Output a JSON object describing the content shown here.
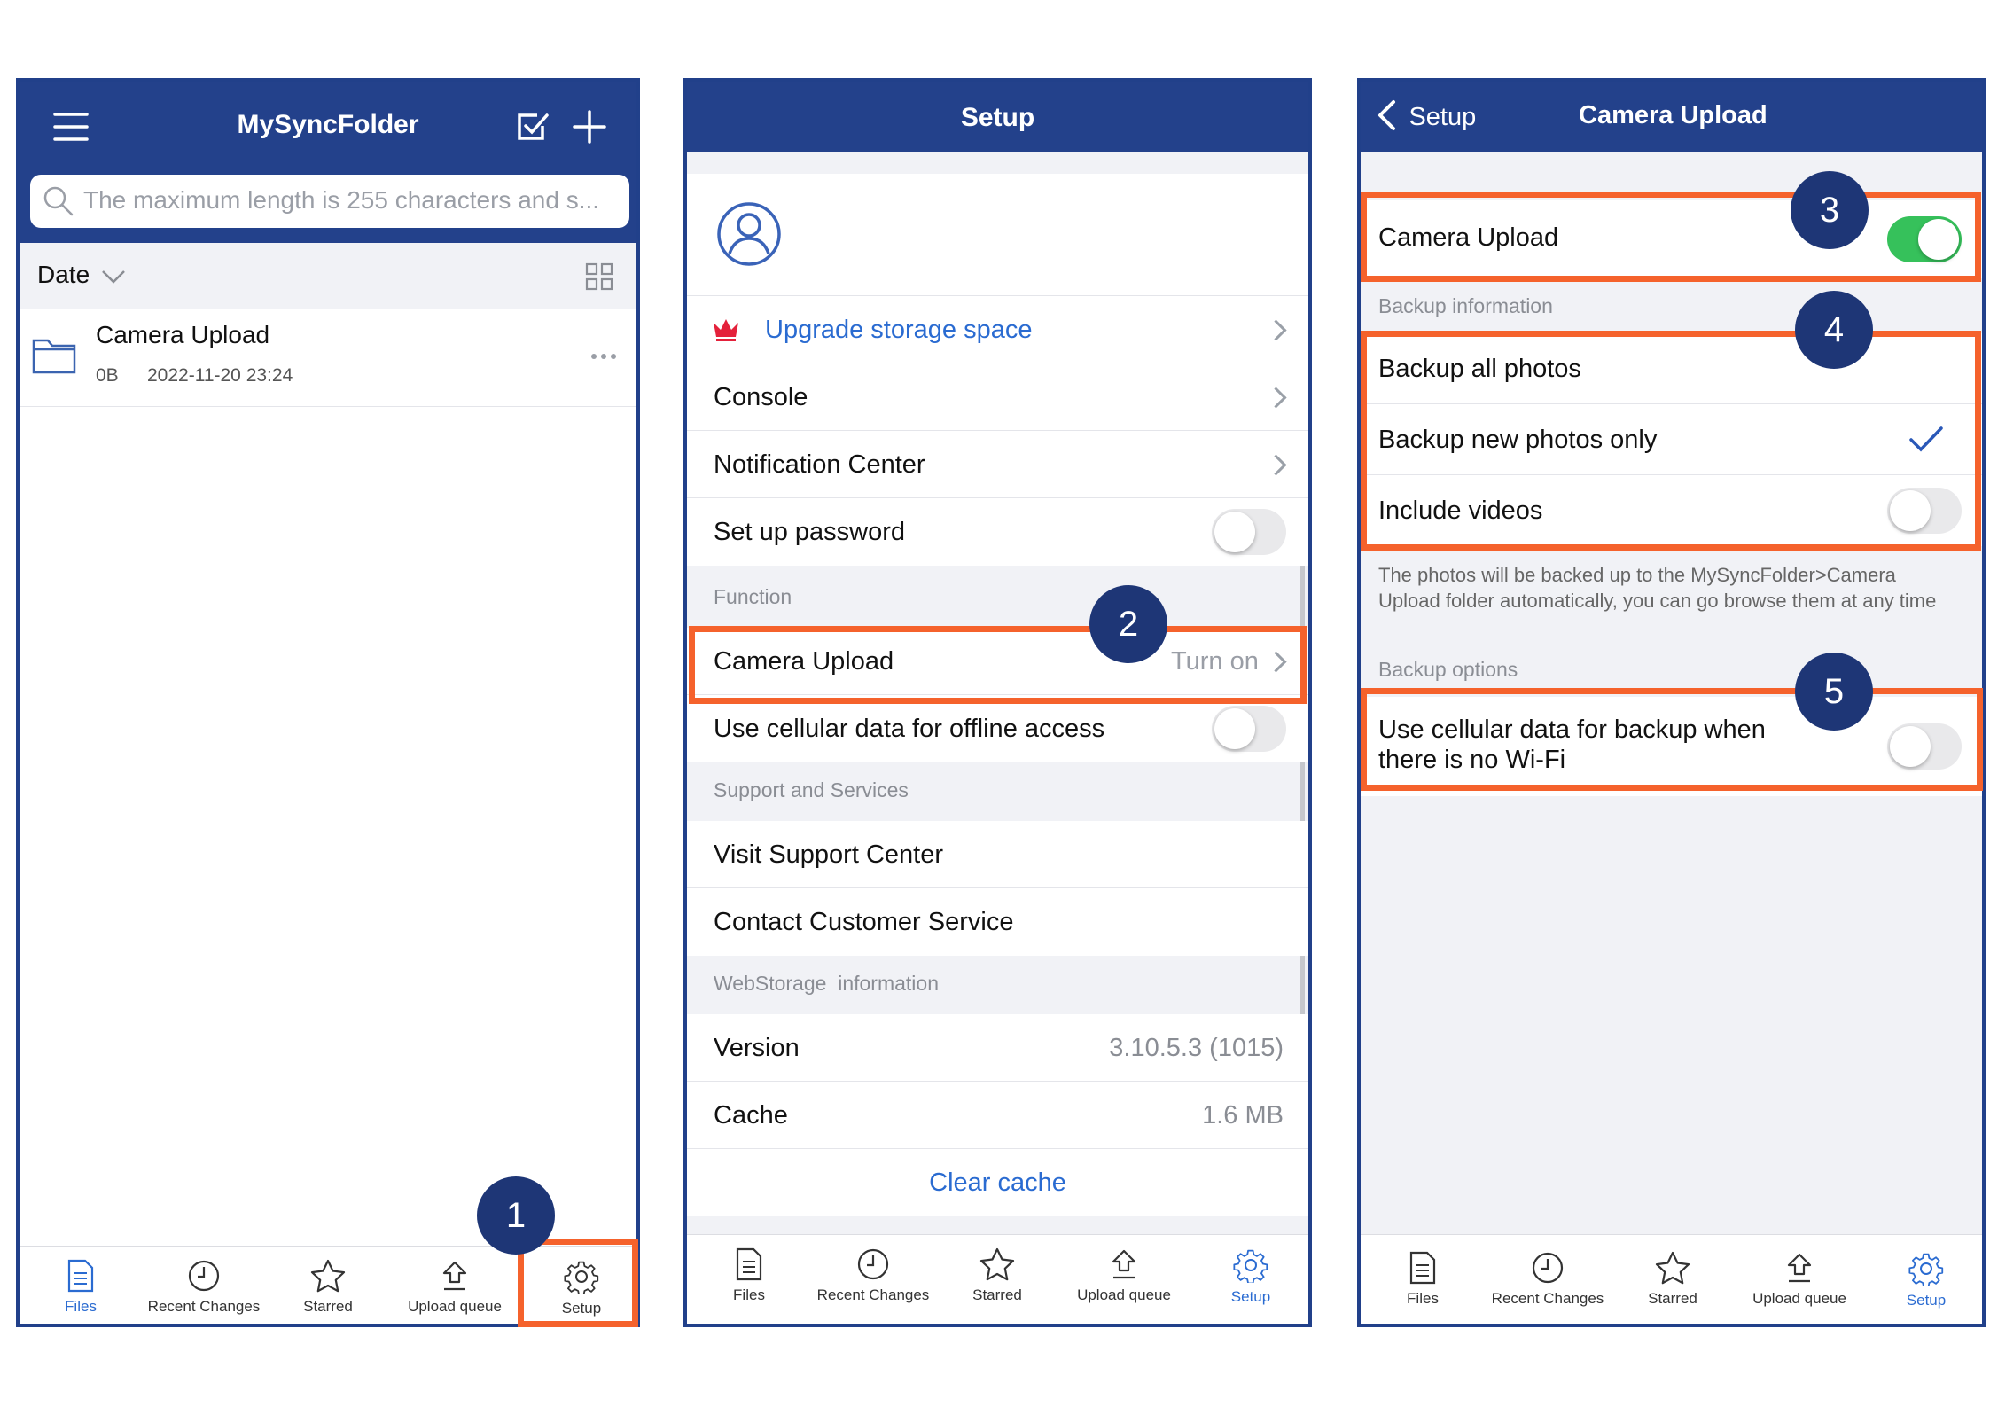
{
  "screen1": {
    "title": "MySyncFolder",
    "search_placeholder": "The maximum length is 255 characters and s...",
    "sort_label": "Date",
    "file": {
      "name": "Camera Upload",
      "size": "0B",
      "date": "2022-11-20 23:24"
    },
    "tabs": [
      "Files",
      "Recent Changes",
      "Starred",
      "Upload queue",
      "Setup"
    ],
    "badge": "1"
  },
  "screen2": {
    "title": "Setup",
    "upgrade": "Upgrade storage space",
    "console": "Console",
    "notification": "Notification Center",
    "password": "Set up password",
    "section_function": "Function",
    "camera_upload": "Camera Upload",
    "camera_upload_status": "Turn on",
    "cellular_offline": "Use cellular data for offline access",
    "section_support": "Support and Services",
    "visit_support": "Visit Support Center",
    "contact": "Contact Customer Service",
    "section_info": "WebStorage  information",
    "version_label": "Version",
    "version_value": "3.10.5.3 (1015)",
    "cache_label": "Cache",
    "cache_value": "1.6 MB",
    "clear_cache": "Clear cache",
    "tabs": [
      "Files",
      "Recent Changes",
      "Starred",
      "Upload queue",
      "Setup"
    ],
    "badge": "2"
  },
  "screen3": {
    "back": "Setup",
    "title": "Camera Upload",
    "camera_upload": "Camera Upload",
    "section_backup_info": "Backup information",
    "backup_all": "Backup all photos",
    "backup_new": "Backup new photos only",
    "include_videos": "Include videos",
    "note": "The photos will be backed up to the MySyncFolder>Camera Upload folder automatically, you can go browse them at any time",
    "section_backup_options": "Backup options",
    "cellular_backup": "Use cellular data for backup when there is no Wi-Fi",
    "tabs": [
      "Files",
      "Recent Changes",
      "Starred",
      "Upload queue",
      "Setup"
    ],
    "badges": [
      "3",
      "4",
      "5"
    ]
  },
  "colors": {
    "header": "#23418b",
    "accent_blue": "#2a6bd1",
    "highlight": "#f5622c",
    "badge": "#1e3676",
    "toggle_on": "#36c15b"
  },
  "icons": [
    "menu-icon",
    "check-square-icon",
    "plus-icon",
    "search-icon",
    "chevron-down-icon",
    "grid-icon",
    "folder-icon",
    "more-icon",
    "user-icon",
    "crown-icon",
    "chevron-right-icon",
    "checkmark-icon",
    "back-chevron-icon",
    "file-icon",
    "clock-icon",
    "star-icon",
    "upload-icon",
    "gear-icon"
  ]
}
